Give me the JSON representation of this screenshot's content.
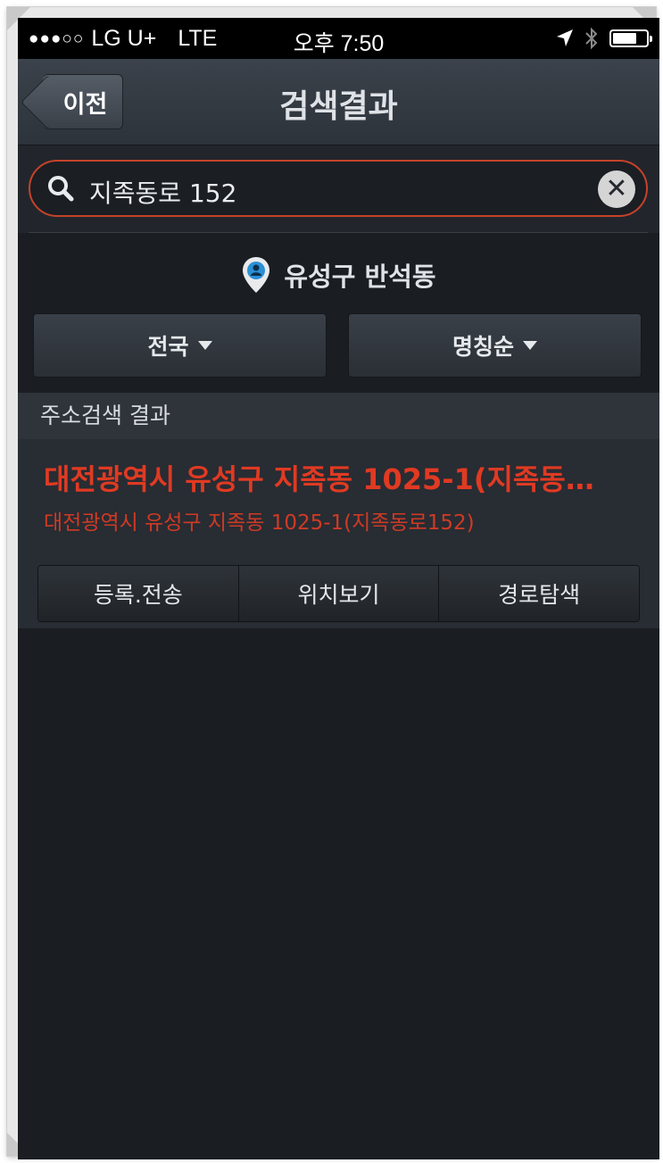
{
  "status_bar": {
    "signal": "●●●○○",
    "carrier": "LG U+",
    "network": "LTE",
    "time": "오후 7:50",
    "location_icon": "location-arrow-icon",
    "bluetooth_icon": "bluetooth-icon",
    "battery_level": 0.72
  },
  "nav": {
    "back_label": "이전",
    "title": "검색결과"
  },
  "search": {
    "value": "지족동로 152",
    "search_icon": "search-icon",
    "clear_icon": "clear-icon"
  },
  "location": {
    "icon": "map-pin-icon",
    "text": "유성구 반석동"
  },
  "filters": [
    {
      "label": "전국"
    },
    {
      "label": "명칭순"
    }
  ],
  "section": {
    "header": "주소검색 결과"
  },
  "result": {
    "title": "대전광역시 유성구 지족동 1025-1(지족동…",
    "subtitle": "대전광역시 유성구 지족동 1025-1(지족동로152)",
    "actions": [
      {
        "label": "등록.전송"
      },
      {
        "label": "위치보기"
      },
      {
        "label": "경로탐색"
      }
    ]
  },
  "colors": {
    "accent_red": "#e03a22",
    "background": "#1a1d22",
    "search_border": "#c6422a"
  }
}
